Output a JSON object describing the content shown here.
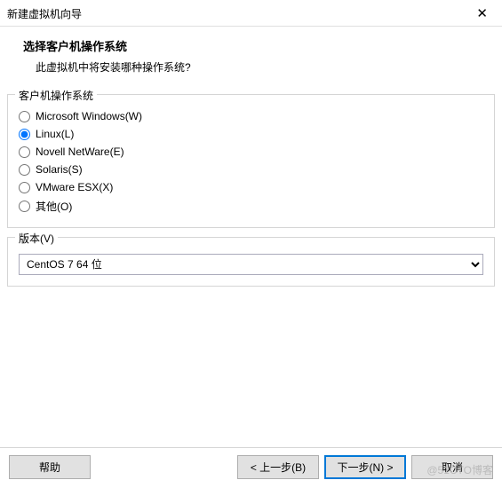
{
  "titlebar": {
    "title": "新建虚拟机向导",
    "close": "✕"
  },
  "header": {
    "title": "选择客户机操作系统",
    "subtitle": "此虚拟机中将安装哪种操作系统?"
  },
  "osGroup": {
    "legend": "客户机操作系统",
    "options": [
      {
        "label": "Microsoft Windows(W)",
        "checked": false
      },
      {
        "label": "Linux(L)",
        "checked": true
      },
      {
        "label": "Novell NetWare(E)",
        "checked": false
      },
      {
        "label": "Solaris(S)",
        "checked": false
      },
      {
        "label": "VMware ESX(X)",
        "checked": false
      },
      {
        "label": "其他(O)",
        "checked": false
      }
    ]
  },
  "versionGroup": {
    "legend": "版本(V)",
    "selected": "CentOS 7 64 位"
  },
  "footer": {
    "help": "帮助",
    "back": "< 上一步(B)",
    "next": "下一步(N) >",
    "cancel": "取消"
  },
  "watermark": "@51CTO博客"
}
